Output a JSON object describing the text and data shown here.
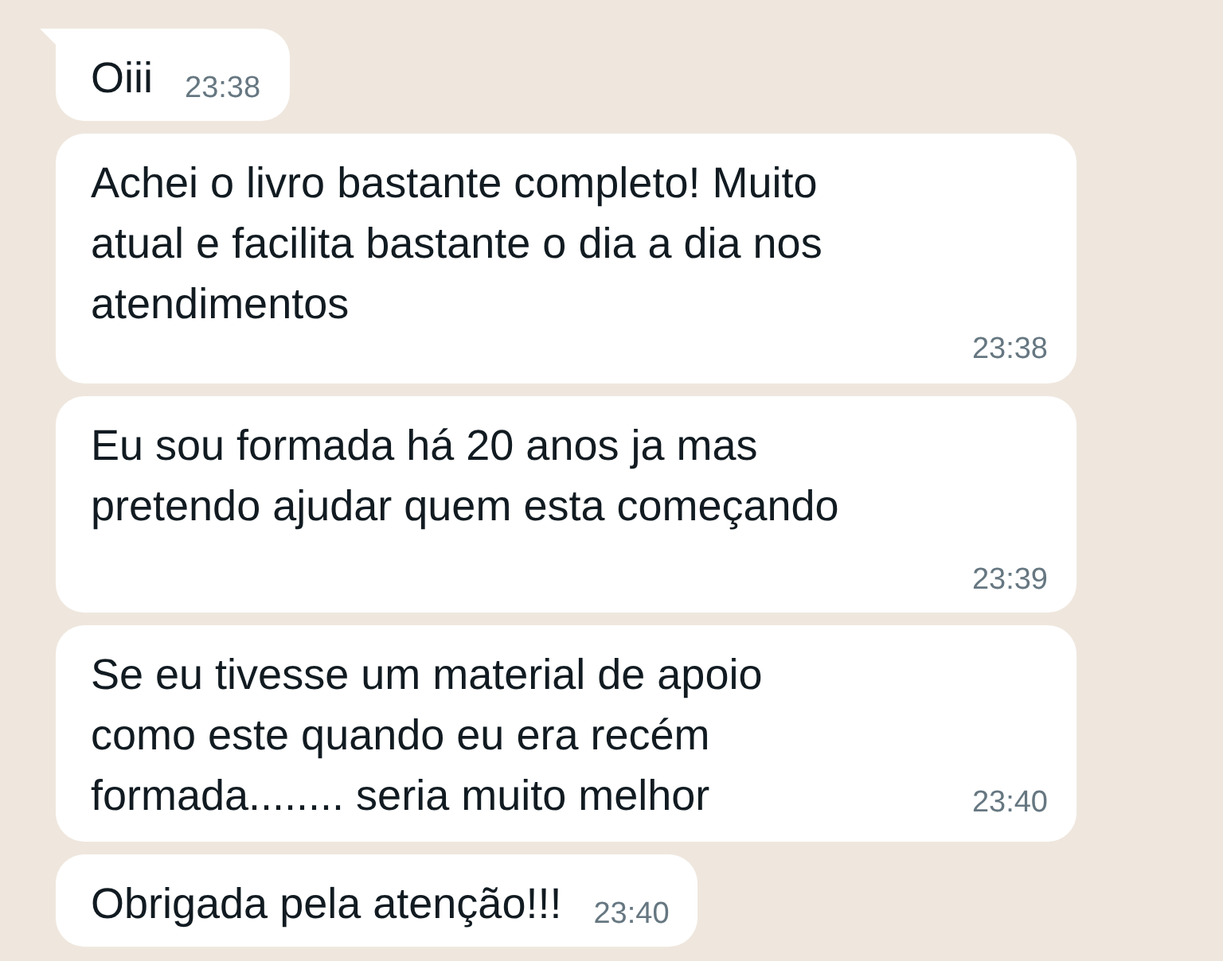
{
  "messages": [
    {
      "kind": "short",
      "text": "Oiii",
      "time": "23:38",
      "tail": true
    },
    {
      "kind": "wide-stacked",
      "text": "Achei o livro bastante completo! Muito\natual e facilita bastante o dia a dia nos\natendimentos",
      "time": "23:38",
      "tail": false
    },
    {
      "kind": "wide-stacked",
      "text": "Eu sou formada há 20 anos ja mas\npretendo ajudar quem esta começando",
      "time": "23:39",
      "tail": false
    },
    {
      "kind": "wide-inline",
      "text": "Se eu tivesse um material de apoio\ncomo este quando eu era recém\nformada........ seria muito melhor",
      "time": "23:40",
      "tail": false
    },
    {
      "kind": "short",
      "text": "Obrigada pela atenção!!!",
      "time": "23:40",
      "tail": false
    }
  ]
}
